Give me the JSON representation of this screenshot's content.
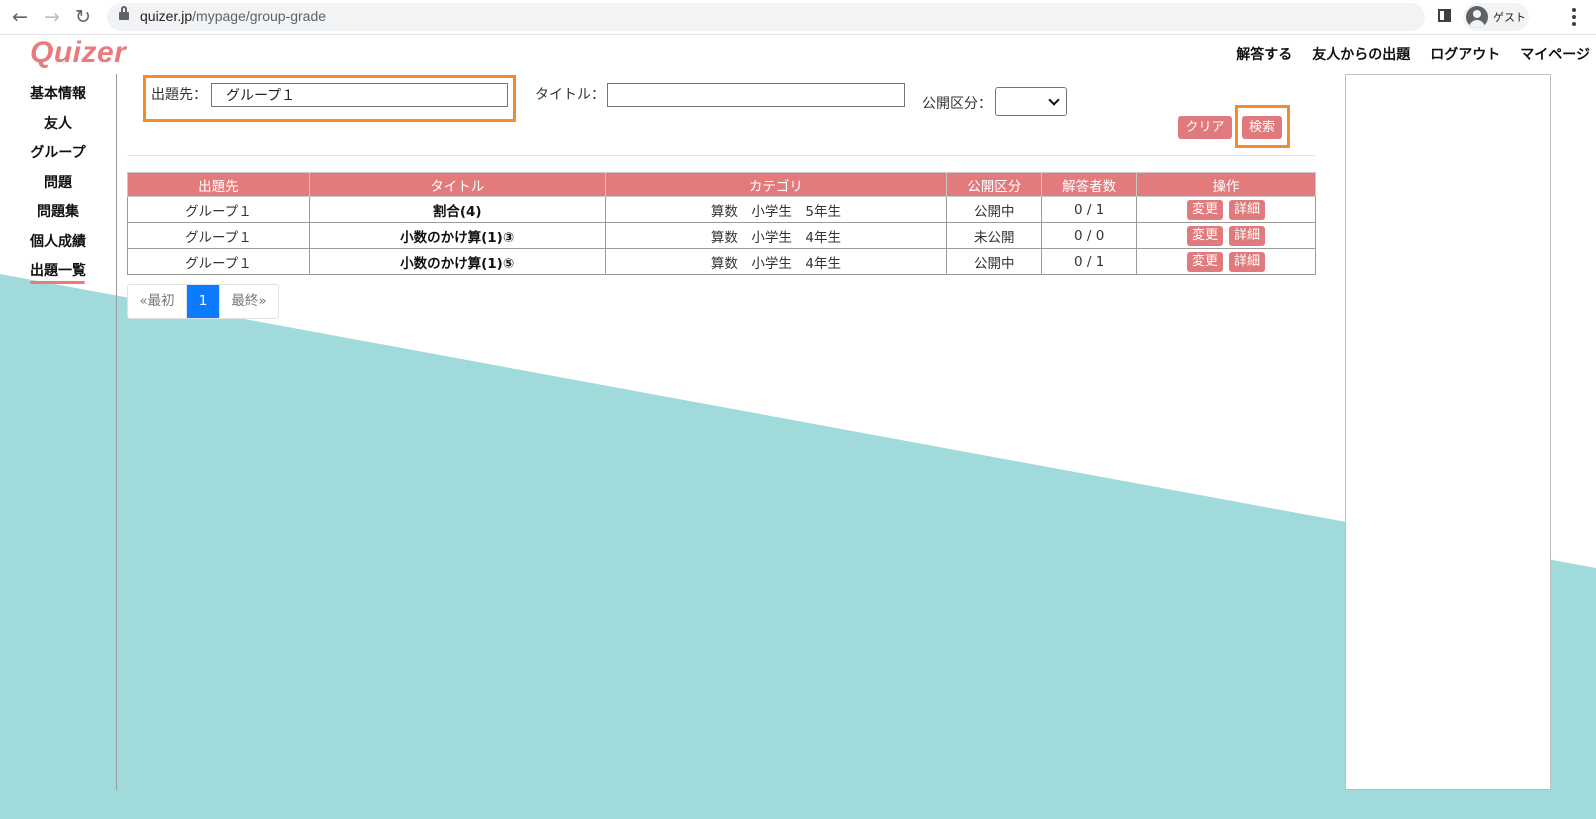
{
  "browser": {
    "url_host": "quizer.jp",
    "url_path": "/mypage/group-grade",
    "profile_label": "ゲスト"
  },
  "site": {
    "logo": "Quizer",
    "top_nav": [
      "解答する",
      "友人からの出題",
      "ログアウト",
      "マイページ"
    ]
  },
  "sidebar": {
    "items": [
      {
        "label": "基本情報"
      },
      {
        "label": "友人"
      },
      {
        "label": "グループ"
      },
      {
        "label": "問題"
      },
      {
        "label": "問題集"
      },
      {
        "label": "個人成績"
      },
      {
        "label": "出題一覧"
      }
    ],
    "active_index": 6
  },
  "search": {
    "target_label": "出題先：",
    "target_value": "グループ１",
    "title_label": "タイトル：",
    "title_value": "",
    "visibility_label": "公開区分：",
    "visibility_value": "",
    "clear_label": "クリア",
    "search_label": "検索"
  },
  "table": {
    "headers": [
      "出題先",
      "タイトル",
      "カテゴリ",
      "公開区分",
      "解答者数",
      "操作"
    ],
    "rows": [
      {
        "target": "グループ１",
        "title": "割合(4)",
        "category": "算数　小学生　5年生",
        "visibility": "公開中",
        "respondents": "0 / 1"
      },
      {
        "target": "グループ１",
        "title": "小数のかけ算(1)③",
        "category": "算数　小学生　4年生",
        "visibility": "未公開",
        "respondents": "0 / 0"
      },
      {
        "target": "グループ１",
        "title": "小数のかけ算(1)⑤",
        "category": "算数　小学生　4年生",
        "visibility": "公開中",
        "respondents": "0 / 1"
      }
    ],
    "edit_label": "変更",
    "detail_label": "詳細"
  },
  "pagination": {
    "first_label": "«最初",
    "current_page": "1",
    "last_label": "最終»"
  },
  "colors": {
    "accent": "#e07a7d",
    "teal_background": "#a0dadb",
    "highlight": "#f58a2a",
    "page_active": "#0d7bff"
  }
}
